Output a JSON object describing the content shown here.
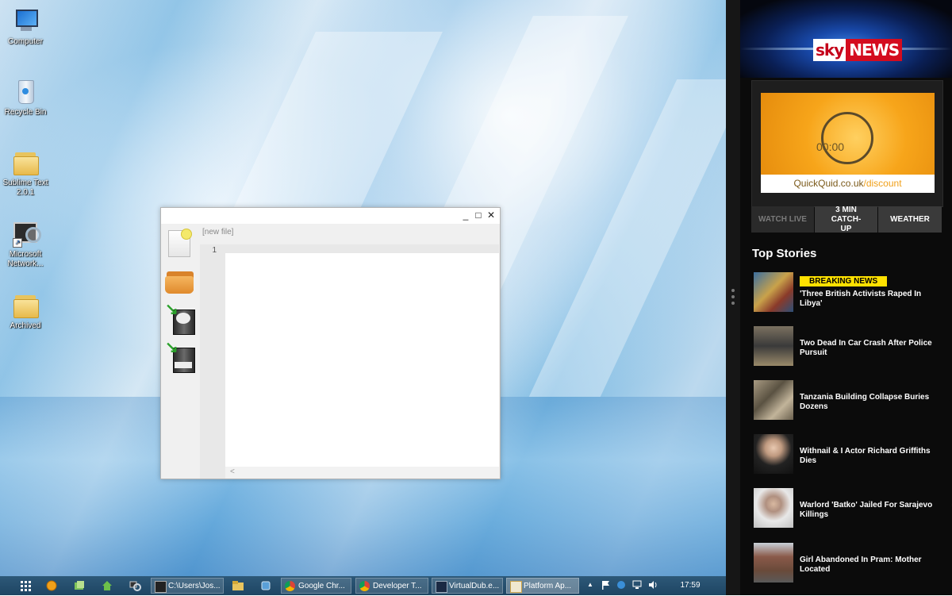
{
  "desktop": {
    "icons": [
      {
        "label": "Computer"
      },
      {
        "label": "Recycle Bin"
      },
      {
        "label": "Sublime Text 2.0.1"
      },
      {
        "label": "Microsoft Network..."
      },
      {
        "label": "Archived"
      }
    ]
  },
  "editor": {
    "tab_label": "[new file]",
    "line_number": "1",
    "scroll_left": "<",
    "minimize": "_",
    "maximize": "□",
    "close": "✕"
  },
  "sky": {
    "logo_sky": "sky",
    "logo_news": "NEWS",
    "ad": {
      "timer": "00:00",
      "brand": "QuickQuid.co.uk",
      "brand_suffix": "/discount"
    },
    "tabs": [
      {
        "label": "WATCH LIVE"
      },
      {
        "label": "3 MIN CATCH-UP"
      },
      {
        "label": "WEATHER"
      }
    ],
    "section_title": "Top Stories",
    "stories": [
      {
        "badge": "BREAKING NEWS",
        "headline": "'Three British Activists Raped In Libya'"
      },
      {
        "headline": "Two Dead In Car Crash After Police Pursuit"
      },
      {
        "headline": "Tanzania Building Collapse Buries Dozens"
      },
      {
        "headline": "Withnail & I Actor Richard Griffiths Dies"
      },
      {
        "headline": "Warlord 'Batko' Jailed For Sarajevo Killings"
      },
      {
        "headline": "Girl Abandoned In Pram: Mother Located"
      }
    ]
  },
  "taskbar": {
    "buttons": [
      {
        "label": "C:\\Users\\Jos..."
      },
      {
        "label": "Google Chr..."
      },
      {
        "label": "Developer T..."
      },
      {
        "label": "VirtualDub.e..."
      },
      {
        "label": "Platform Ap..."
      }
    ],
    "clock": "17:59",
    "tray_up": "▲"
  },
  "colors": {
    "sky_red": "#d40c1f",
    "badge_yellow": "#ffe100",
    "taskbar": "#2d5878"
  }
}
